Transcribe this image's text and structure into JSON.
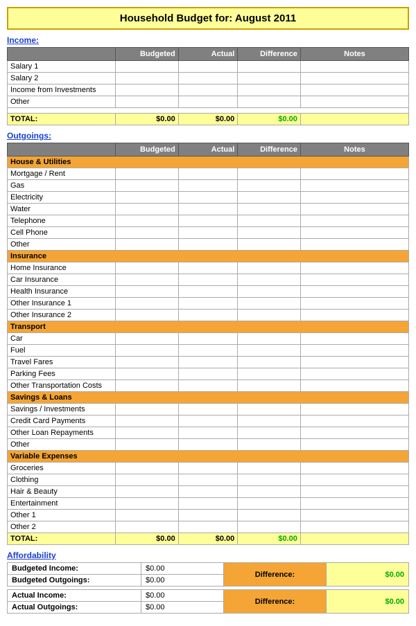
{
  "title": {
    "prefix": "Household Budget for:",
    "month": "August 2011",
    "full": "Household Budget for:   August 2011"
  },
  "income": {
    "section_label": "Income:",
    "columns": [
      "",
      "Budgeted",
      "Actual",
      "Difference",
      "Notes"
    ],
    "rows": [
      {
        "label": "Salary 1",
        "budgeted": "",
        "actual": "",
        "difference": "",
        "notes": ""
      },
      {
        "label": "Salary 2",
        "budgeted": "",
        "actual": "",
        "difference": "",
        "notes": ""
      },
      {
        "label": "Income from Investments",
        "budgeted": "",
        "actual": "",
        "difference": "",
        "notes": ""
      },
      {
        "label": "Other",
        "budgeted": "",
        "actual": "",
        "difference": "",
        "notes": ""
      }
    ],
    "total_label": "TOTAL:",
    "total_budgeted": "$0.00",
    "total_actual": "$0.00",
    "total_difference": "$0.00"
  },
  "outgoings": {
    "section_label": "Outgoings:",
    "columns": [
      "",
      "Budgeted",
      "Actual",
      "Difference",
      "Notes"
    ],
    "categories": [
      {
        "category": "House & Utilities",
        "rows": [
          "Mortgage / Rent",
          "Gas",
          "Electricity",
          "Water",
          "Telephone",
          "Cell Phone",
          "Other"
        ]
      },
      {
        "category": "Insurance",
        "rows": [
          "Home Insurance",
          "Car Insurance",
          "Health Insurance",
          "Other Insurance 1",
          "Other Insurance 2"
        ]
      },
      {
        "category": "Transport",
        "rows": [
          "Car",
          "Fuel",
          "Travel Fares",
          "Parking Fees",
          "Other Transportation Costs"
        ]
      },
      {
        "category": "Savings & Loans",
        "rows": [
          "Savings / Investments",
          "Credit Card Payments",
          "Other Loan Repayments",
          "Other"
        ]
      },
      {
        "category": "Variable Expenses",
        "rows": [
          "Groceries",
          "Clothing",
          "Hair & Beauty",
          "Entertainment",
          "Other 1",
          "Other 2"
        ]
      }
    ],
    "total_label": "TOTAL:",
    "total_budgeted": "$0.00",
    "total_actual": "$0.00",
    "total_difference": "$0.00"
  },
  "affordability": {
    "section_label": "Affordability",
    "budgeted_income_label": "Budgeted Income:",
    "budgeted_income_value": "$0.00",
    "budgeted_outgoings_label": "Budgeted Outgoings:",
    "budgeted_outgoings_value": "$0.00",
    "budgeted_difference_label": "Difference:",
    "budgeted_difference_value": "$0.00",
    "actual_income_label": "Actual Income:",
    "actual_income_value": "$0.00",
    "actual_outgoings_label": "Actual Outgoings:",
    "actual_outgoings_value": "$0.00",
    "actual_difference_label": "Difference:",
    "actual_difference_value": "$0.00"
  }
}
